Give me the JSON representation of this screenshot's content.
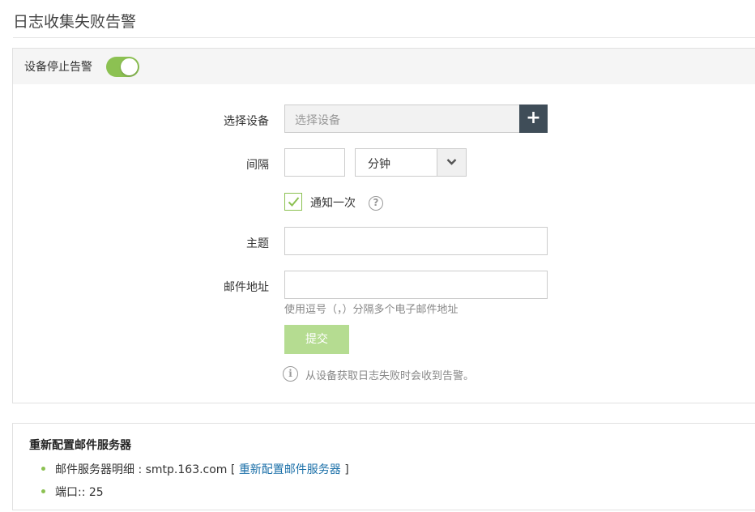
{
  "page": {
    "title": "日志收集失败告警"
  },
  "panel": {
    "header_label": "设备停止告警",
    "toggle_on": true
  },
  "form": {
    "device_label": "选择设备",
    "device_placeholder": "选择设备",
    "add_symbol": "+",
    "interval_label": "间隔",
    "interval_value": "",
    "interval_unit": "分钟",
    "notify_once_label": "通知一次",
    "notify_once_checked": true,
    "help_symbol": "?",
    "subject_label": "主题",
    "subject_value": "",
    "email_label": "邮件地址",
    "email_value": "",
    "email_hint": "使用逗号（，）分隔多个电子邮件地址",
    "submit_label": "提交",
    "info_symbol": "i",
    "info_text": "从设备获取日志失败时会收到告警。"
  },
  "mail_server": {
    "title": "重新配置邮件服务器",
    "detail_prefix": "邮件服务器明细 : smtp.163.com [ ",
    "detail_link": "重新配置邮件服务器",
    "detail_suffix": " ]",
    "port_text": "端口:: 25"
  },
  "colors": {
    "accent_green": "#8cc152",
    "dark_button": "#3f4d58",
    "link_blue": "#1a6fa8"
  }
}
